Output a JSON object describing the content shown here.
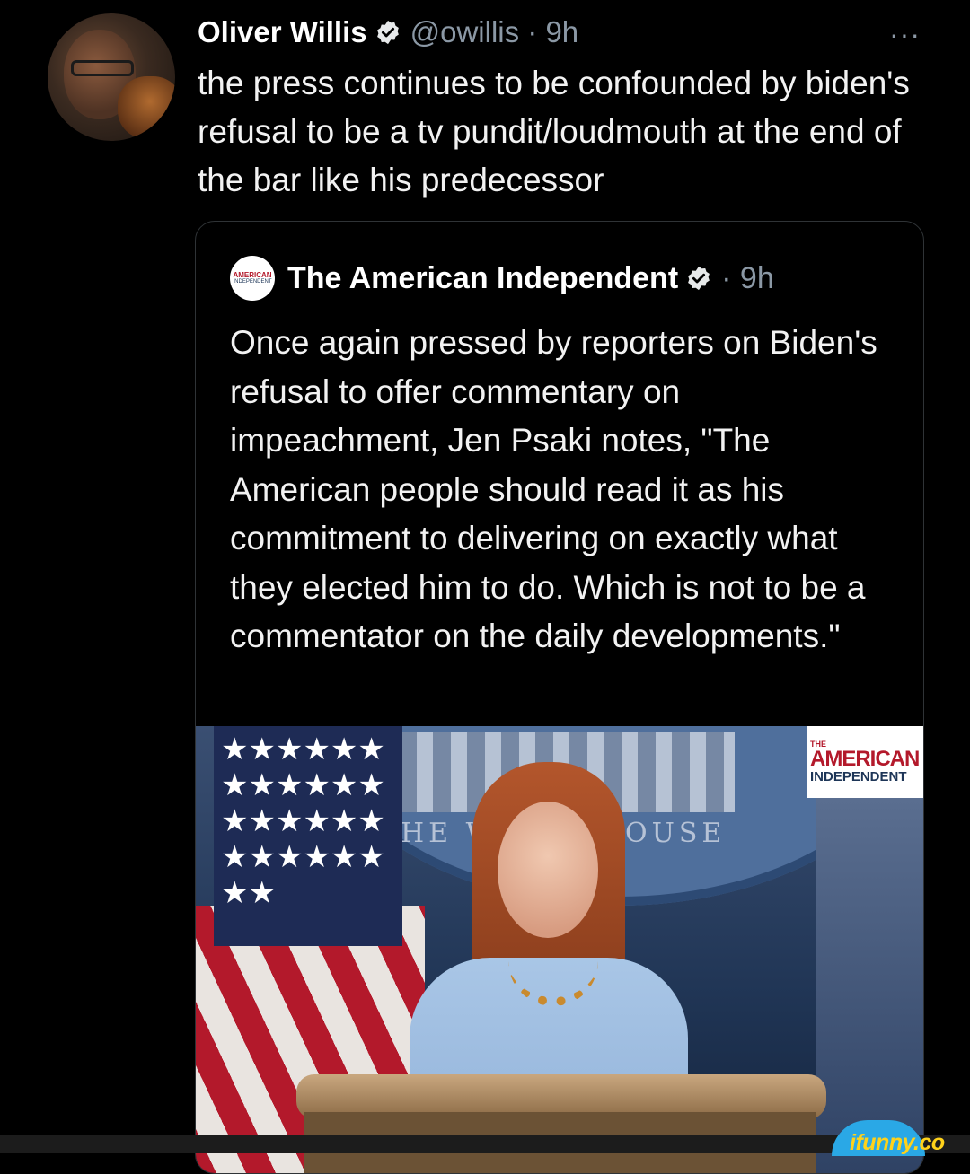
{
  "tweet": {
    "author_name": "Oliver Willis",
    "verified_icon": "verified-badge-icon",
    "meta": "@owillis · 9h",
    "more_label": "···",
    "text": "the press continues to be confounded by biden's refusal to be a tv pundit/loudmouth at the end of the bar like his predecessor"
  },
  "quote": {
    "logo_line1": "AMERICAN",
    "logo_line2": "INDEPENDENT",
    "author_name": "The American Independent",
    "verified_icon": "verified-badge-icon",
    "meta": "· 9h",
    "text": "Once again pressed by reporters on Biden's refusal to offer commentary on impeachment, Jen Psaki notes, \"The American people should read it as his commitment to delivering on exactly what they elected him to do. Which is not to be a commentator on the daily developments.\"",
    "media": {
      "watermark_line1": "THE",
      "watermark_line2": "AMERICAN",
      "watermark_line3": "INDEPENDENT",
      "seal_text_left": "HE W",
      "seal_text_right": "OUSE"
    }
  },
  "footer": {
    "ifunny_label": "ifunny.co"
  },
  "colors": {
    "background": "#000000",
    "text": "#f2f2f2",
    "muted": "#8b98a5",
    "verified": "#1d9bf0",
    "border": "#2f3336",
    "ifunny_yellow": "#ffd21a"
  }
}
